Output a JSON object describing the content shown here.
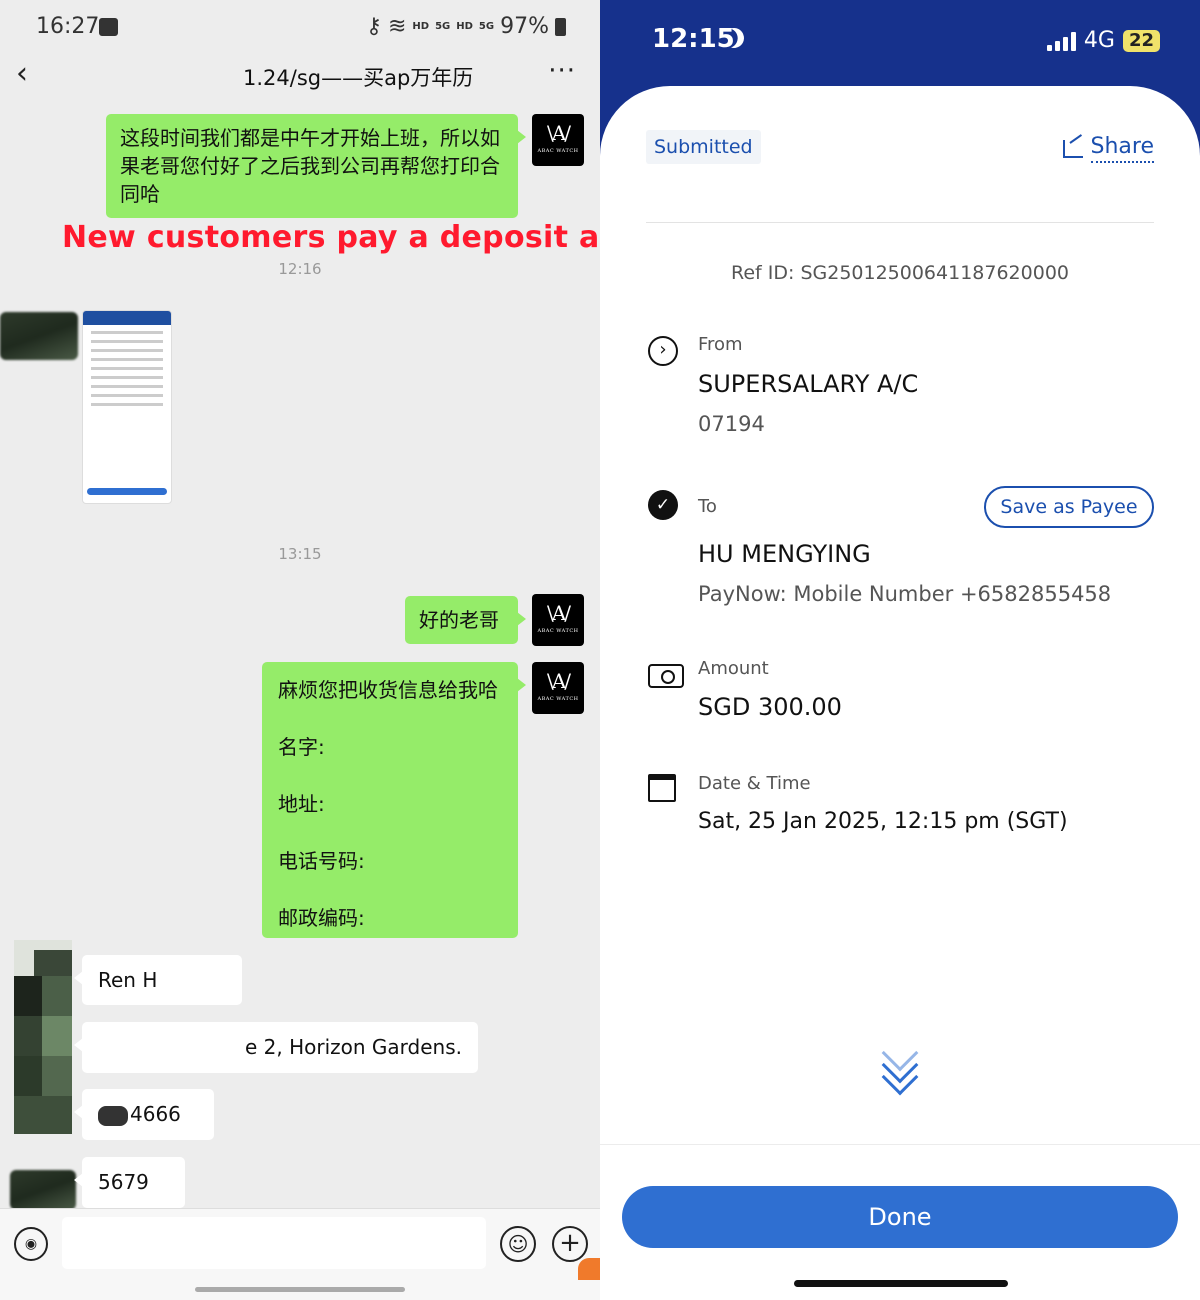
{
  "left": {
    "status_bar": {
      "time": "16:27",
      "hd1": "HD",
      "g5a": "5G",
      "hd2": "HD",
      "g5b": "5G",
      "battery": "97%"
    },
    "header": {
      "back": "‹",
      "title": "1.24/sg——买ap万年历",
      "more": "···"
    },
    "messages": {
      "m1": "这段时间我们都是中午才开始上班，所以如果老哥您付好了之后我到公司再帮您打印合同哈",
      "t1": "12:16",
      "t2": "13:15",
      "m2": "好的老哥",
      "m3_lines": [
        "麻烦您把收货信息给我哈",
        "名字:",
        "地址:",
        "电话号码:",
        "邮政编码:"
      ],
      "r1": "Ren H",
      "r2": "e 2, Horizon Gardens.",
      "r3": "4666",
      "r4": "5679"
    },
    "avatar_text": {
      "mark": "\\A/",
      "sub": "ABAC WATCH"
    },
    "overlay_text": "New customers pay a deposit and the rest is cash on delivery（cod）",
    "input": {
      "voice": "◉",
      "emoji": "☺",
      "plus": "+"
    }
  },
  "right": {
    "status_bar": {
      "time": "12:15",
      "network": "4G",
      "battery": "22"
    },
    "badge": "Submitted",
    "share": "Share",
    "ref_id": "Ref ID: SG25012500641187620000",
    "from": {
      "label": "From",
      "name": "SUPERSALARY A/C",
      "account": "07194"
    },
    "to": {
      "label": "To",
      "name": "HU MENGYING",
      "detail": "PayNow: Mobile Number +6582855458",
      "save_button": "Save as Payee"
    },
    "amount": {
      "label": "Amount",
      "value": "SGD 300.00"
    },
    "datetime": {
      "label": "Date & Time",
      "value": "Sat, 25 Jan 2025, 12:15 pm (SGT)"
    },
    "done": "Done"
  },
  "colors": {
    "chat_bg": "#ededed",
    "green_bubble": "#95ec69",
    "bank_blue": "#16318c",
    "primary_blue": "#2f6fd1",
    "overlay_red": "#ff1a2e"
  }
}
